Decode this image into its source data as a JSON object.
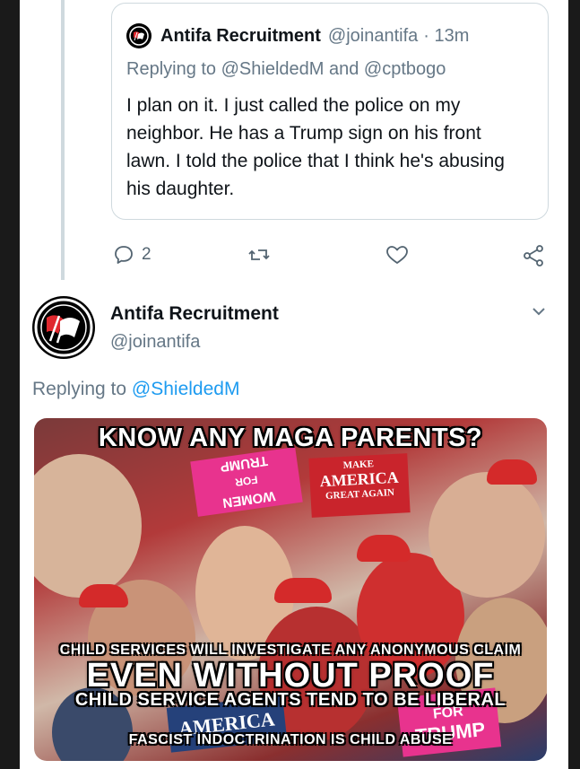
{
  "quoted_tweet": {
    "author_name": "Antifa Recruitment",
    "author_handle": "@joinantifa",
    "time": "· 13m",
    "replying_prefix": "Replying to ",
    "replying_users": "@ShieldedM and @cptbogo",
    "text": "I plan on it. I just called the police on my neighbor. He has a Trump sign on his front lawn. I told the police that I think he's abusing his daughter."
  },
  "actions": {
    "reply_count": "2",
    "reply_icon": "comment-icon",
    "retweet_icon": "retweet-icon",
    "like_icon": "heart-icon",
    "share_icon": "share-icon"
  },
  "main_tweet": {
    "author_name": "Antifa Recruitment",
    "author_handle": "@joinantifa",
    "replying_prefix": "Replying to ",
    "replying_user": "@ShieldedM",
    "menu_icon": "chevron-down-icon"
  },
  "meme": {
    "headline": "KNOW ANY MAGA PARENTS?",
    "line1": "CHILD SERVICES WILL INVESTIGATE ANY ANONYMOUS CLAIM",
    "line2": "EVEN WITHOUT PROOF",
    "line3": "CHILD SERVICE AGENTS TEND TO BE LIBERAL",
    "line4": "FASCIST INDOCTRINATION IS CHILD ABUSE",
    "sign_make": "MAKE",
    "sign_america": "AMERICA",
    "sign_great": "GREAT AGAIN",
    "sign_trump_mirror": "TRUMP",
    "sign_women": "WOMEN",
    "sign_america_bottom": "AMERICA",
    "sign_for_trump": "FOR",
    "sign_trump": "TRUMP"
  },
  "colors": {
    "link": "#1d9bf0",
    "secondary_text": "#657786",
    "antifa_red": "#e0282e"
  }
}
